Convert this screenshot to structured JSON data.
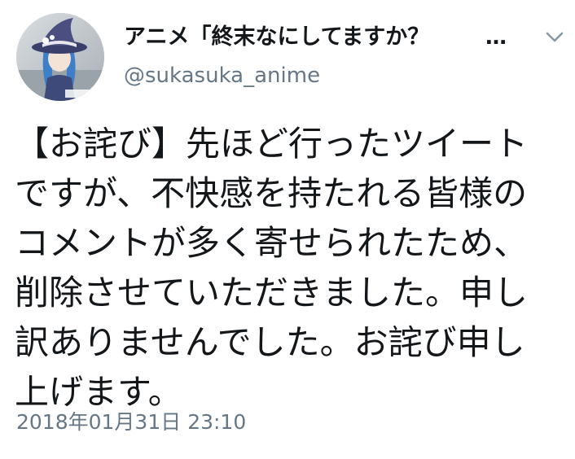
{
  "tweet": {
    "display_name": "アニメ「終末なにしてますか？",
    "name_overflow": "…",
    "handle": "@sukasuka_anime",
    "text_lines": [
      "【お詫び】先ほど行ったツイート",
      "ですが、不快感を持たれる皆様の",
      "コメントが多く寄せられたため、",
      "削除させていただきました。申し",
      "訳ありませんでした。お詫び申し",
      "上げます。"
    ],
    "timestamp": "2018年01月31日 23:10",
    "menu_icon": "chevron-down-icon",
    "avatar_icon": "witch-character-avatar"
  },
  "colors": {
    "text_primary": "#14171a",
    "text_secondary": "#657786",
    "background": "#ffffff"
  }
}
